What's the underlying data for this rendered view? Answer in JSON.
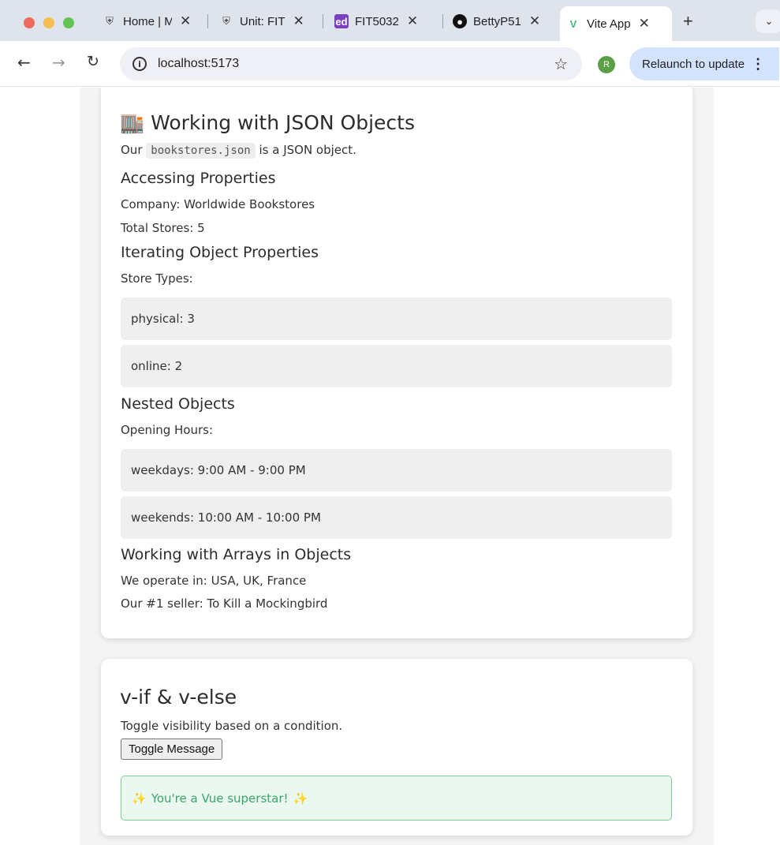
{
  "browser": {
    "tabs": [
      {
        "title": "Home | M",
        "favicon": "monash-crest-icon"
      },
      {
        "title": "Unit: FIT",
        "favicon": "monash-crest-icon"
      },
      {
        "title": "FIT5032",
        "favicon": "ed-icon"
      },
      {
        "title": "BettyP51",
        "favicon": "github-icon"
      },
      {
        "title": "Vite App",
        "favicon": "vue-icon",
        "active": true
      }
    ],
    "new_tab": "+",
    "url": "localhost:5173",
    "avatar_letter": "R",
    "relaunch_label": "Relaunch to update"
  },
  "json_section": {
    "heading_icon": "🏬",
    "heading": "Working with JSON Objects",
    "intro_prefix": "Our",
    "intro_code": "bookstores.json",
    "intro_suffix": "is a JSON object.",
    "accessing_heading": "Accessing Properties",
    "company_line": "Company: Worldwide Bookstores",
    "total_line": "Total Stores: 5",
    "iterating_heading": "Iterating Object Properties",
    "store_types_label": "Store Types:",
    "store_types": [
      "physical: 3",
      "online: 2"
    ],
    "nested_heading": "Nested Objects",
    "opening_label": "Opening Hours:",
    "opening_hours": [
      "weekdays: 9:00 AM - 9:00 PM",
      "weekends: 10:00 AM - 10:00 PM"
    ],
    "arrays_heading": "Working with Arrays in Objects",
    "countries_line": "We operate in: USA, UK, France",
    "seller_line": "Our #1 seller: To Kill a Mockingbird"
  },
  "vif_section": {
    "heading": "v-if & v-else",
    "description": "Toggle visibility based on a condition.",
    "button_label": "Toggle Message",
    "message_text": "You're a Vue superstar!",
    "sparkle": "✨"
  },
  "colors": {
    "success_border": "#7fcf9a",
    "success_text": "#3aa56b",
    "relaunch_bg": "#d3e3fd"
  }
}
